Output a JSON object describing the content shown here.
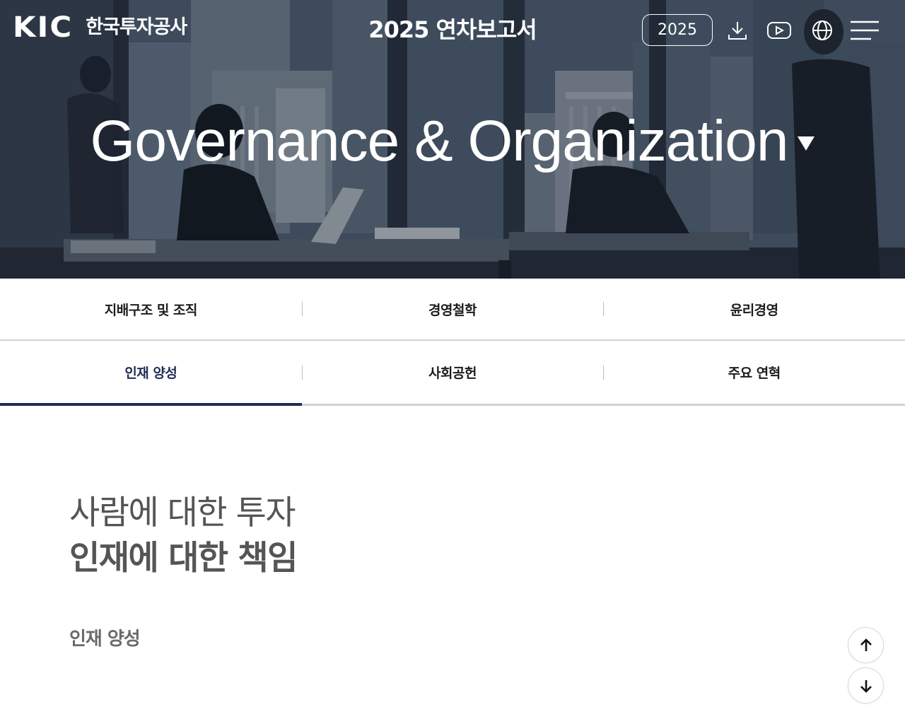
{
  "header": {
    "logo_mark": "KIC",
    "logo_text": "한국투자공사",
    "report_title": "2025 연차보고서",
    "year_button": "2025",
    "icons": [
      "download-icon",
      "youtube-icon",
      "globe-icon",
      "menu-icon"
    ]
  },
  "hero": {
    "title": "Governance & Organization"
  },
  "tabs": {
    "row1": [
      {
        "label": "지배구조 및 조직"
      },
      {
        "label": "경영철학"
      },
      {
        "label": "윤리경영"
      }
    ],
    "row2": [
      {
        "label": "인재 양성",
        "active": true
      },
      {
        "label": "사회공헌"
      },
      {
        "label": "주요 연혁"
      }
    ]
  },
  "content": {
    "lead": "사람에 대한 투자",
    "lead_strong": "인재에 대한 책임",
    "section_label": "인재 양성"
  },
  "colors": {
    "accent": "#1f2d52",
    "divider": "#cfd2d6",
    "text_gray": "#555555"
  },
  "scroll_buttons": [
    "arrow-up-icon",
    "arrow-down-icon"
  ]
}
